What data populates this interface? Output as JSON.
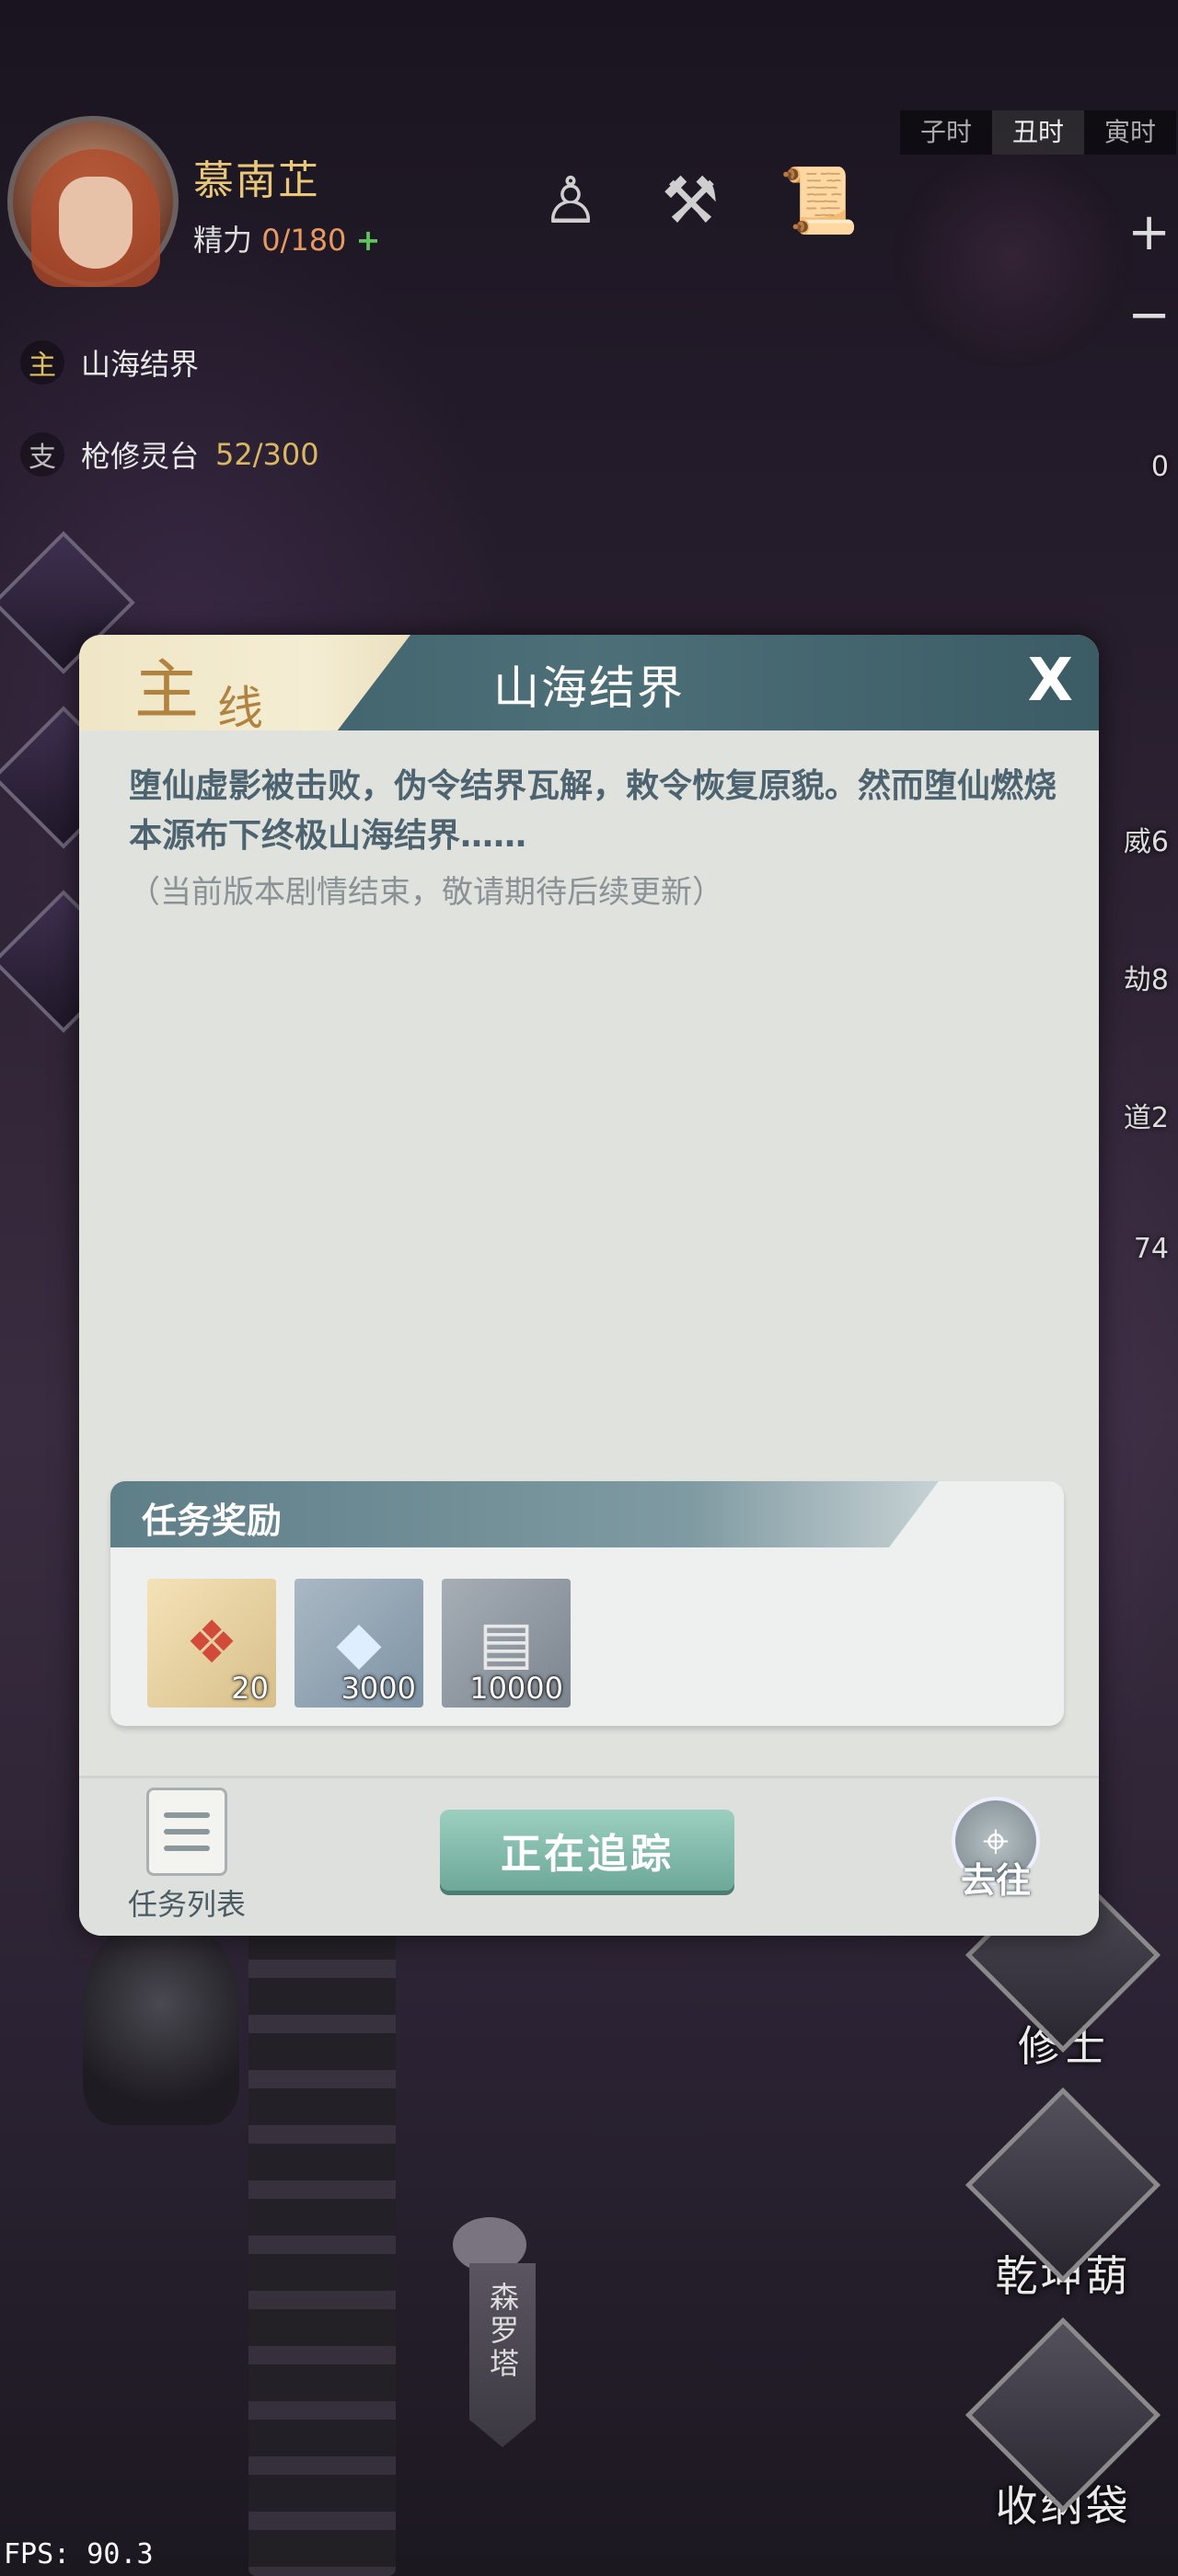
{
  "player": {
    "name": "慕南芷",
    "energy_label": "精力",
    "energy_value": "0/180",
    "energy_plus": "+"
  },
  "quests": [
    {
      "tag": "主",
      "title": "山海结界",
      "progress": ""
    },
    {
      "tag": "支",
      "title": "枪修灵台",
      "progress": "52/300"
    }
  ],
  "time_bar": [
    "子时",
    "丑时",
    "寅时"
  ],
  "time_active": "丑时",
  "zoom": {
    "plus": "+",
    "minus": "−"
  },
  "right_counts": [
    "0",
    "威6",
    "劫8",
    "道2",
    "74"
  ],
  "side_menu": [
    {
      "label": "修士",
      "icon": "cultivator-icon"
    },
    {
      "label": "乾坤葫",
      "icon": "gourd-icon"
    },
    {
      "label": "收纳袋",
      "icon": "bag-icon"
    }
  ],
  "tower_label": "森罗塔",
  "fps": "FPS: 90.3",
  "dialog": {
    "tag_big": "主",
    "tag_small": "线",
    "title": "山海结界",
    "close": "X",
    "body": "堕仙虚影被击败，伪令结界瓦解，敕令恢复原貌。然而堕仙燃烧本源布下终极山海结界……",
    "note": "（当前版本剧情结束，敬请期待后续更新）",
    "reward_title": "任务奖励",
    "rewards": [
      {
        "count": "20",
        "icon": "talisman-icon"
      },
      {
        "count": "3000",
        "icon": "spirit-crystal-icon"
      },
      {
        "count": "10000",
        "icon": "scroll-icon"
      }
    ],
    "list_label": "任务列表",
    "track_label": "正在追踪",
    "goto_label": "去往"
  }
}
